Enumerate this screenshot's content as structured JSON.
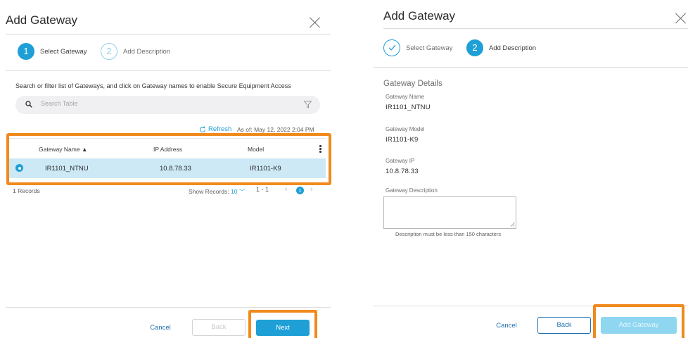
{
  "left": {
    "title": "Add Gateway",
    "steps": [
      {
        "number": "1",
        "label": "Select Gateway"
      },
      {
        "number": "2",
        "label": "Add Description"
      }
    ],
    "instruction": "Search or filter list of Gateways, and click on Gateway names to enable Secure Equipment Access",
    "search_placeholder": "Search Table",
    "refresh_label": "Refresh",
    "as_of": "As of: May 12, 2022 2:04 PM",
    "table": {
      "columns": [
        "Gateway Name ▲",
        "IP Address",
        "Model"
      ],
      "rows": [
        {
          "gateway_name": "IR1101_NTNU",
          "ip_address": "10.8.78.33",
          "model": "IR1101-K9"
        }
      ]
    },
    "records": "1 Records",
    "show_records_label": "Show Records:",
    "show_records_value": "10",
    "range": "1 - 1",
    "current_page": "1",
    "buttons": {
      "cancel": "Cancel",
      "back": "Back",
      "next": "Next"
    }
  },
  "right": {
    "title": "Add Gateway",
    "steps": [
      {
        "number": "",
        "label": "Select Gateway"
      },
      {
        "number": "2",
        "label": "Add Description"
      }
    ],
    "section_title": "Gateway Details",
    "fields": [
      {
        "label": "Gateway Name",
        "value": "IR1101_NTNU"
      },
      {
        "label": "Gateway Model",
        "value": "IR1101-K9"
      },
      {
        "label": "Gateway IP",
        "value": "10.8.78.33"
      }
    ],
    "description_label": "Gateway Description",
    "description_hint": "Description must be less than 150 characters",
    "buttons": {
      "cancel": "Cancel",
      "back": "Back",
      "add": "Add Gateway"
    }
  },
  "colors": {
    "accent": "#1e9fd6",
    "highlight": "#f08a1c",
    "selected_row": "#cde9f5"
  }
}
